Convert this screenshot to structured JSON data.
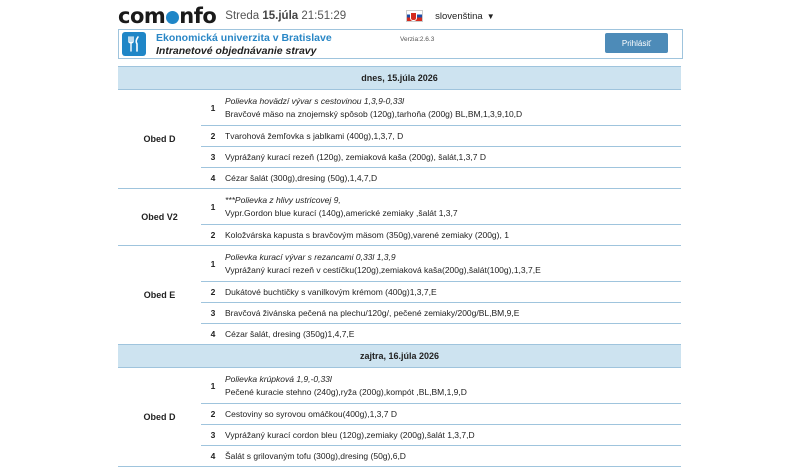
{
  "topbar": {
    "logo_prefix": "com",
    "logo_suffix": "nfo",
    "day_name": "Streda",
    "date": "15.júla",
    "time": "21:51:29",
    "language": "slovenština",
    "flag_icon": "slovak-flag-icon"
  },
  "header": {
    "icon": "cutlery-icon",
    "school_name": "Ekonomická univerzita v Bratislave",
    "subtitle": "Intranetové objednávanie stravy",
    "version": "Verzia:2.6.3",
    "login_label": "Prihlásiť"
  },
  "days": [
    {
      "title": "dnes, 15.júla 2026",
      "meals": [
        {
          "name": "Obed D",
          "items": [
            {
              "num": "1",
              "soup": "Polievka hovädzí vývar s cestovinou 1,3,9-0,33l",
              "dish": "Bravčové mäso na znojemský spôsob (120g),tarhoňa (200g) BL,BM,1,3,9,10,D"
            },
            {
              "num": "2",
              "soup": "",
              "dish": "Tvarohová žemľovka s jablkami (400g),1,3,7, D"
            },
            {
              "num": "3",
              "soup": "",
              "dish": "Vyprážaný kurací rezeň (120g), zemiaková kaša (200g), šalát,1,3,7 D"
            },
            {
              "num": "4",
              "soup": "",
              "dish": "Cézar šalát (300g),dresing (50g),1,4,7,D"
            }
          ]
        },
        {
          "name": "Obed V2",
          "items": [
            {
              "num": "1",
              "soup": "***Polievka z hlivy ustricovej 9,",
              "dish": "Vypr.Gordon blue kurací (140g),americké zemiaky ,šalát 1,3,7"
            },
            {
              "num": "2",
              "soup": "",
              "dish": "Koložvárska kapusta s bravčovým mäsom (350g),varené zemiaky (200g), 1"
            }
          ]
        },
        {
          "name": "Obed E",
          "items": [
            {
              "num": "1",
              "soup": "Polievka kurací vývar s rezancami 0,33l 1,3,9",
              "dish": "Vyprážaný kurací rezeň v cestíčku(120g),zemiaková kaša(200g),šalát(100g),1,3,7,E"
            },
            {
              "num": "2",
              "soup": "",
              "dish": "Dukátové buchtičky s vanilkovým krémom (400g)1,3,7,E"
            },
            {
              "num": "3",
              "soup": "",
              "dish": "Bravčová živánska pečená na plechu/120g/, pečené zemiaky/200g/BL,BM,9,E"
            },
            {
              "num": "4",
              "soup": "",
              "dish": "Cézar šalát, dresing (350g)1,4,7,E"
            }
          ]
        }
      ]
    },
    {
      "title": "zajtra, 16.júla 2026",
      "meals": [
        {
          "name": "Obed D",
          "items": [
            {
              "num": "1",
              "soup": "Polievka krúpková 1,9,-0,33l",
              "dish": "Pečené kuracie stehno (240g),ryža (200g),kompót ,BL,BM,1,9,D"
            },
            {
              "num": "2",
              "soup": "",
              "dish": "Cestoviny so syrovou omáčkou(400g),1,3,7 D"
            },
            {
              "num": "3",
              "soup": "",
              "dish": "Vyprážaný kurací cordon bleu (120g),zemiaky (200g),šalát 1,3,7,D"
            },
            {
              "num": "4",
              "soup": "",
              "dish": "Šalát s grilovaným tofu (300g),dresing (50g),6,D"
            }
          ]
        }
      ]
    }
  ]
}
